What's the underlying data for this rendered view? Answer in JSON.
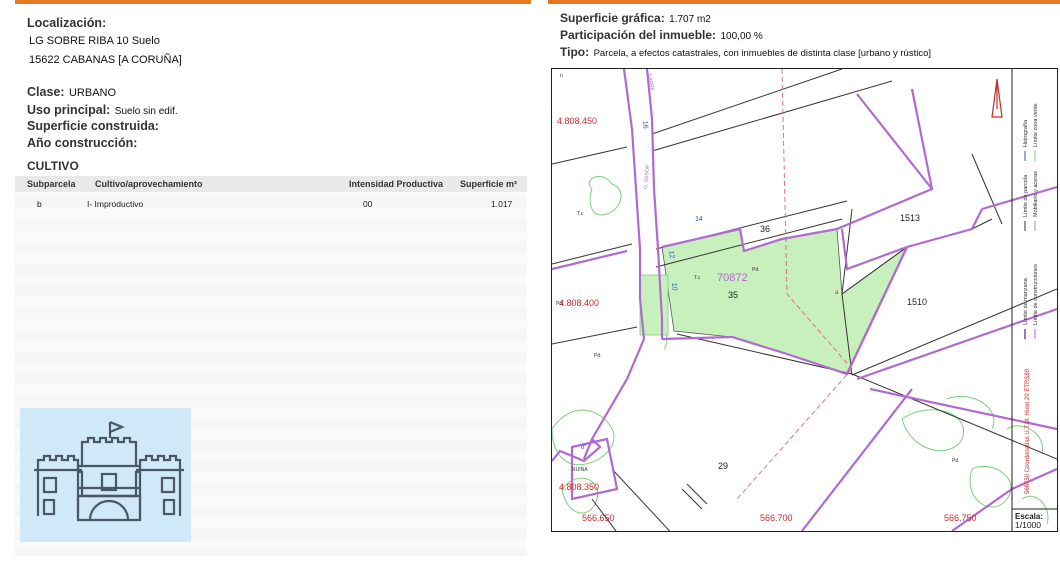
{
  "left": {
    "localizacion_label": "Localización:",
    "address_line1": "LG SOBRE RIBA 10 Suelo",
    "address_line2": "15622 CABANAS [A CORUÑA]",
    "clase_label": "Clase:",
    "clase_value": "URBANO",
    "uso_label": "Uso principal:",
    "uso_value": "Suelo sin edif.",
    "superficie_construida_label": "Superficie construida:",
    "anio_label": "Año construcción:",
    "cultivo_title": "CULTIVO",
    "table": {
      "headers": [
        "Subparcela",
        "Cultivo/aprovechamiento",
        "Intensidad Productiva",
        "Superficie m²"
      ],
      "rows": [
        [
          "b",
          "I- Improductivo",
          "00",
          "1.017"
        ]
      ]
    }
  },
  "right": {
    "superficie_grafica_label": "Superficie gráfica:",
    "superficie_grafica_value": "1.707 m2",
    "participacion_label": "Participación del inmueble:",
    "participacion_value": "100,00 %",
    "tipo_label": "Tipo:",
    "tipo_value": "Parcela, a efectos catastrales, con inmuebles de distinta clase [urbano y rústico]"
  },
  "map": {
    "coord_y1": "4.808.450",
    "coord_y2": "4.808.400",
    "coord_y3": "4.808.350",
    "coord_x1": "566.650",
    "coord_x2": "566.700",
    "coord_x3": "566.750",
    "parcel_main": "70872",
    "label_35": "35",
    "label_36": "36",
    "label_1513": "1513",
    "label_1510": "1510",
    "label_29": "29",
    "label_a": "a",
    "label_14": "14",
    "label_12": "12",
    "label_16": "16",
    "label_10": "10",
    "label_6": "6",
    "label_te1": "T.c",
    "label_te2": "T.c",
    "label_pd1": "Pd.",
    "label_pd2": "Pd.",
    "label_pd3": "Pd.",
    "label_pd4": "Pd.",
    "label_n": "n",
    "label_ruina": "RUINA",
    "label_carretera": "CARRE",
    "label_street": "O. SRSOP",
    "legend": {
      "item1": "Límite de manzana",
      "item2": "Límite de parcela",
      "item3": "Hidrografía",
      "item4": "Límite de construcciones",
      "item5": "Mobiliario y aceras",
      "item6": "Límite zona verde",
      "utm": "566750 Coordenadas U.T.M. Huso 29 ETRS89"
    },
    "scale_label": "Escala:",
    "scale_value": "1/1000"
  },
  "colors": {
    "accent": "#e87722",
    "parcel_fill": "#c8f0bd",
    "block_line": "#b06ad0",
    "coord_red": "#cc2a2a",
    "hydro_blue": "#2b55c8"
  }
}
